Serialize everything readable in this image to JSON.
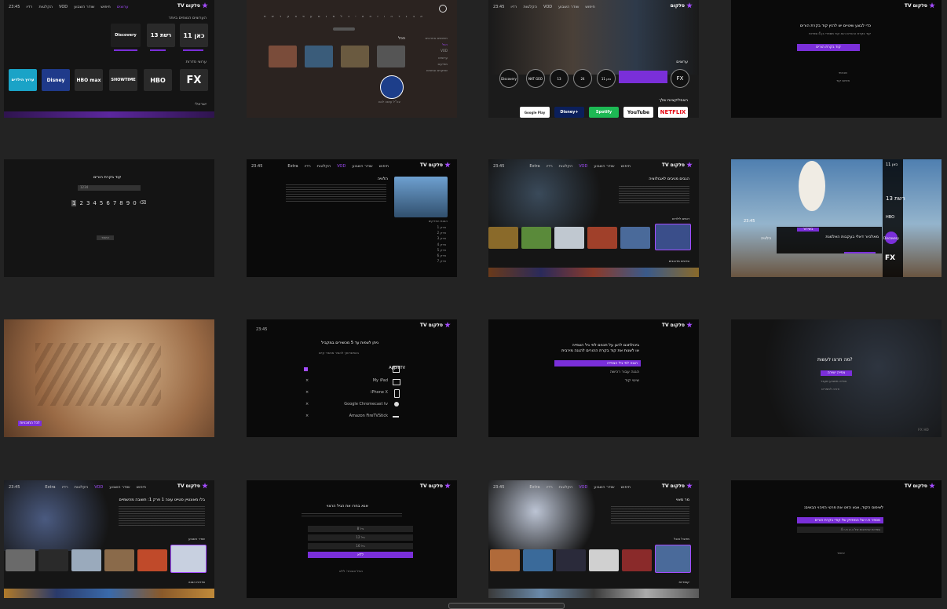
{
  "clock": "23:45",
  "brand": {
    "name": "סלקום",
    "tv": "TV"
  },
  "nav": [
    "ערוצים",
    "חיפוש",
    "שודר השבוע",
    "VOD",
    "הקלטות",
    "רדיו",
    "Extra"
  ],
  "f1": {
    "section1": "הערוצים הנצפים ביותר",
    "section2": "ערוצי סדרות",
    "section3": "ישראלי",
    "tiles1": [
      "כאן 11",
      "13 רשת",
      "Discovery"
    ],
    "tiles2": [
      "FX",
      "HBO",
      "SHOWTIME",
      "HBO max",
      "Disney",
      "ערוץ הילדים"
    ]
  },
  "f2": {
    "heading": "הכל",
    "menu": [
      "חיפושים אחרונים",
      "הכל",
      "VOD",
      "ערוצים",
      "מפיקים",
      "שחקנים ובמאים"
    ],
    "caption": "צה\"ל עושה לכם"
  },
  "f3": {
    "section1": "ערוצים",
    "section2": "האפליקציות שלך",
    "channels": [
      "FX",
      "כאן 11",
      "24",
      "13",
      "NAT GEO",
      "Discovery"
    ],
    "apps": [
      "NETFLIX",
      "YouTube",
      "Spotify",
      "Disney+",
      "Google Play"
    ]
  },
  "f4": {
    "title": "כדי לבצע שינויים יש להזין קוד בקרת הורים",
    "body": "קוד בקרת ההורים הוא קוד מספרי בן 4 ספרות",
    "button": "קוד בקרת הורים",
    "links": [
      "שכחתי",
      "איפוס קוד"
    ]
  },
  "f5": {
    "title": "קוד בקרת הורים",
    "field": "1234",
    "digits": [
      "1",
      "2",
      "3",
      "4",
      "5",
      "6",
      "7",
      "8",
      "9",
      "0"
    ],
    "ok": "אישור"
  },
  "f6": {
    "title": "הלוויה",
    "episodesLabel": "הצגת הפרקים",
    "episodes": [
      "פרק 1",
      "פרק 2",
      "פרק 3",
      "פרק 4",
      "פרק 5",
      "פרק 6",
      "פרק 7"
    ]
  },
  "f7": {
    "title": "הגבים מגיבים לאבולוציה",
    "section1": "דומים לילדים",
    "section2": "סרטים מדובבים"
  },
  "f8": {
    "channelStrip": [
      "כאן 11",
      "13 רשת",
      "HBO",
      "Discovery",
      "FX"
    ],
    "programTitle": "מאלכיור דאלי בעקבות האלמנת",
    "time": "23:45",
    "tag": "בשידור",
    "side": "הלוויה"
  },
  "f9": {
    "button": "לכל התוכניות"
  },
  "f10": {
    "clock": "23:45",
    "title": "ניתן לצפות עד 5 מכשירים במקביל",
    "subtitle": "באפשרותך להסיר מכשיר קיים",
    "devices": [
      "AppleTV",
      "My iPad",
      "iPhone X",
      "Google Chromecast tv",
      "Amazon FireTVStick"
    ]
  },
  "f11": {
    "line1": "ביכולתכם להגן על תכנים לפי גיל הצפייה",
    "line2": "או לשנות את קוד בקרת ההורים להגנה מירבית",
    "options": [
      "הגנה לפי גיל הצפייה",
      "הגנה עבור רכישה",
      "שינוי קוד"
    ]
  },
  "f12": {
    "title": "מה תרצו לעשות?",
    "options": [
      "צפייה ישירה",
      "צפייה משבוע שעבר",
      "חזרה לתפריט"
    ],
    "watermark": "FX HD"
  },
  "f13": {
    "title": "בלו מאונטיין סטייט עונה 1 פרק 1: תשובה מהשמיים",
    "section1": "שודר השבוע",
    "section2": "סדרות הצגה"
  },
  "f14": {
    "title": "אנא בחרו את הגיל הרצוי",
    "ages": [
      "גיל 8",
      "גיל 12",
      "גיל 16",
      "ללא"
    ],
    "footer": "הגיל הנבחר: ללא"
  },
  "f15": {
    "title": "מר מאוי",
    "section1": "מדובל אוכל",
    "section2": "קומדיות"
  },
  "f16": {
    "title": "לאיפוס הקוד, אנא הזינו את פרטי הזיהוי הבאים:",
    "button": "מספר ת.ז של המחזיק של קודי בקרת הורים",
    "field": "4 ספרות אחרונות של כ.א ת.ז",
    "ok": "אישור"
  }
}
